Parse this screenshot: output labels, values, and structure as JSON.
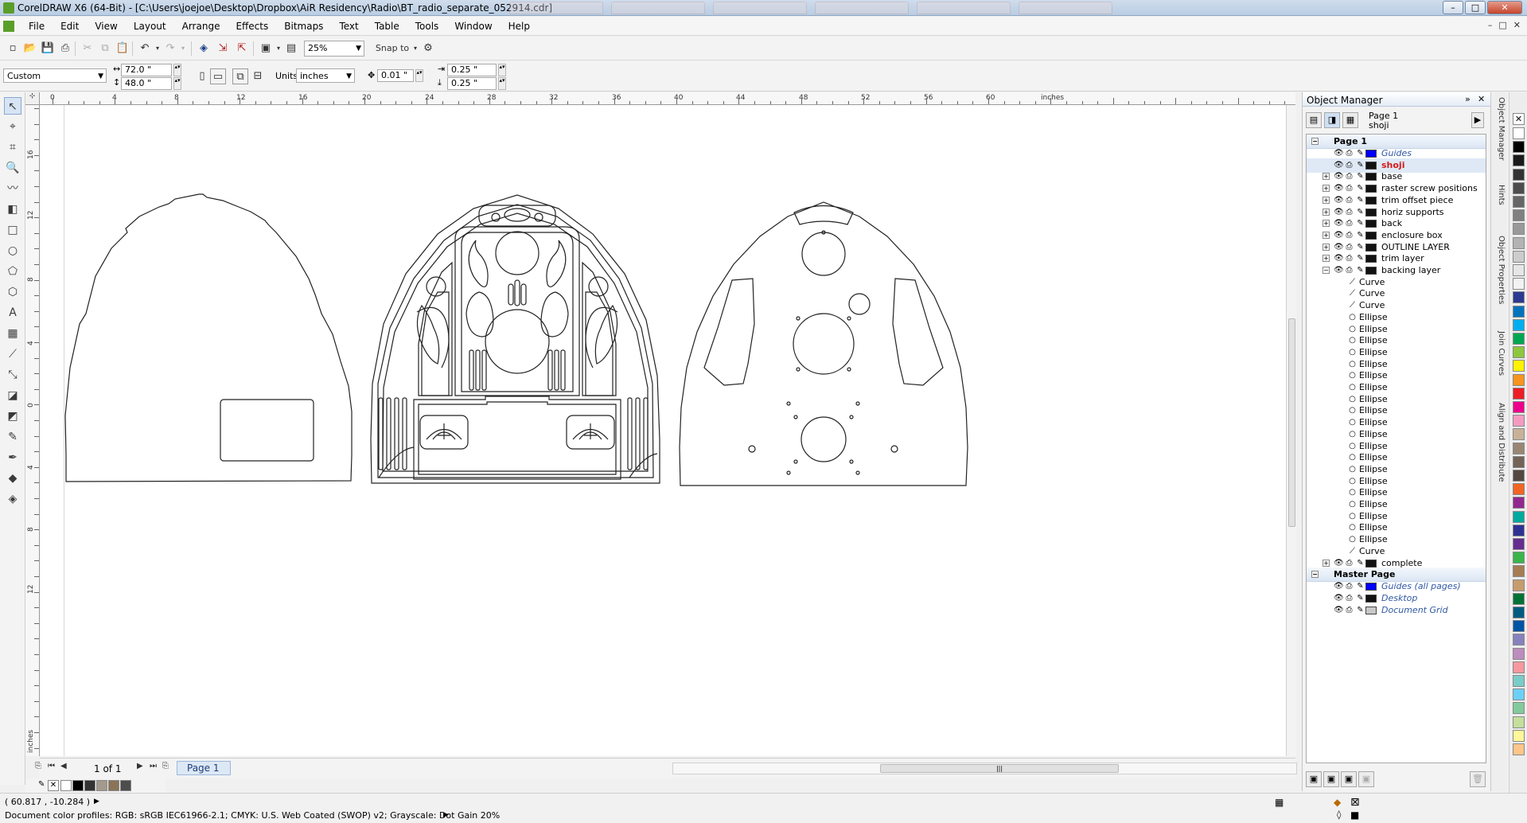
{
  "window": {
    "title": "CorelDRAW X6 (64-Bit) - [C:\\Users\\joejoe\\Desktop\\Dropbox\\AiR Residency\\Radio\\BT_radio_separate_052914.cdr]",
    "buttons": {
      "minimize": "–",
      "maximize": "□",
      "close": "✕"
    }
  },
  "menu": {
    "items": [
      "File",
      "Edit",
      "View",
      "Layout",
      "Arrange",
      "Effects",
      "Bitmaps",
      "Text",
      "Table",
      "Tools",
      "Window",
      "Help"
    ],
    "mdi": [
      "–",
      "□",
      "✕"
    ]
  },
  "standard_toolbar": {
    "zoom": "25%",
    "snap_to": "Snap to"
  },
  "property_bar": {
    "page_size": "Custom",
    "width": "72.0 \"",
    "height": "48.0 \"",
    "units_label": "Units:",
    "units": "inches",
    "nudge": "0.01 \"",
    "dup_x": "0.25 \"",
    "dup_y": "0.25 \""
  },
  "rulers": {
    "h_labels": [
      "0",
      "4",
      "8",
      "12",
      "16",
      "20",
      "24",
      "28",
      "32",
      "36",
      "40",
      "44",
      "48",
      "52",
      "56",
      "60"
    ],
    "h_unit": "inches",
    "v_labels": [
      "16",
      "12",
      "8",
      "4",
      "0",
      "4",
      "8",
      "12"
    ],
    "v_unit": "inches"
  },
  "page_nav": {
    "count": "1 of 1",
    "tab": "Page 1"
  },
  "status": {
    "coords": "( 60.817 , -10.284 )",
    "profiles": "Document color profiles: RGB: sRGB IEC61966-2.1; CMYK: U.S. Web Coated (SWOP) v2; Grayscale: Dot Gain 20%"
  },
  "object_manager": {
    "title": "Object Manager",
    "page_info": {
      "page": "Page 1",
      "layer": "shoji"
    },
    "page1_label": "Page 1",
    "layers": [
      {
        "name": "Guides",
        "style": "italic",
        "color": "#0000ff",
        "expander": ""
      },
      {
        "name": "shoji",
        "style": "red",
        "color": "#111111",
        "expander": ""
      },
      {
        "name": "base",
        "style": "",
        "color": "#111111",
        "expander": "+"
      },
      {
        "name": "raster screw positions",
        "style": "",
        "color": "#111111",
        "expander": "+"
      },
      {
        "name": "trim offset piece",
        "style": "",
        "color": "#111111",
        "expander": "+"
      },
      {
        "name": "horiz supports",
        "style": "",
        "color": "#111111",
        "expander": "+"
      },
      {
        "name": "back",
        "style": "",
        "color": "#111111",
        "expander": "+"
      },
      {
        "name": "enclosure box",
        "style": "",
        "color": "#111111",
        "expander": "+"
      },
      {
        "name": "OUTLINE LAYER",
        "style": "",
        "color": "#111111",
        "expander": "+"
      },
      {
        "name": "trim layer",
        "style": "",
        "color": "#111111",
        "expander": "+"
      },
      {
        "name": "backing layer",
        "style": "",
        "color": "#111111",
        "expander": "−"
      }
    ],
    "children": [
      "Curve",
      "Curve",
      "Curve",
      "Ellipse",
      "Ellipse",
      "Ellipse",
      "Ellipse",
      "Ellipse",
      "Ellipse",
      "Ellipse",
      "Ellipse",
      "Ellipse",
      "Ellipse",
      "Ellipse",
      "Ellipse",
      "Ellipse",
      "Ellipse",
      "Ellipse",
      "Ellipse",
      "Ellipse",
      "Ellipse",
      "Ellipse",
      "Ellipse",
      "Curve"
    ],
    "after_layers": [
      {
        "name": "complete",
        "style": "",
        "color": "#111111",
        "expander": "+"
      }
    ],
    "master_label": "Master Page",
    "master_layers": [
      {
        "name": "Guides (all pages)",
        "style": "italic",
        "color": "#0000ff"
      },
      {
        "name": "Desktop",
        "style": "italic",
        "color": "#111111"
      },
      {
        "name": "Document Grid",
        "style": "italic",
        "color": "#c8c8c8"
      }
    ]
  },
  "docker_tabs": [
    "Object Manager",
    "Hints",
    "Object Properties",
    "Join Curves",
    "Align and Distribute"
  ],
  "palette_colors": [
    "#ffffff",
    "#000000",
    "#1a1a1a",
    "#333333",
    "#4d4d4d",
    "#666666",
    "#808080",
    "#999999",
    "#b3b3b3",
    "#cccccc",
    "#e6e6e6",
    "#f2f2f2",
    "#2b3990",
    "#0072bc",
    "#00aeef",
    "#00a651",
    "#8dc63f",
    "#fff200",
    "#f7941d",
    "#ed1c24",
    "#ec008c",
    "#f49ac1",
    "#c7b299",
    "#998675",
    "#736357",
    "#534741",
    "#f26522",
    "#92278f",
    "#00a99d",
    "#2e3192",
    "#662d91",
    "#39b54a",
    "#a67c52",
    "#c69c6d",
    "#007236",
    "#005b7f",
    "#0054a6",
    "#8781bd",
    "#bd8cbf",
    "#f6989d",
    "#7accc8",
    "#6dcff6",
    "#82ca9c",
    "#c4df9b",
    "#fff799",
    "#fdc689"
  ],
  "doc_palette": [
    "#ffffff",
    "#000000",
    "#333333",
    "#a39a8d",
    "#8b7359",
    "#4d4d4d"
  ]
}
